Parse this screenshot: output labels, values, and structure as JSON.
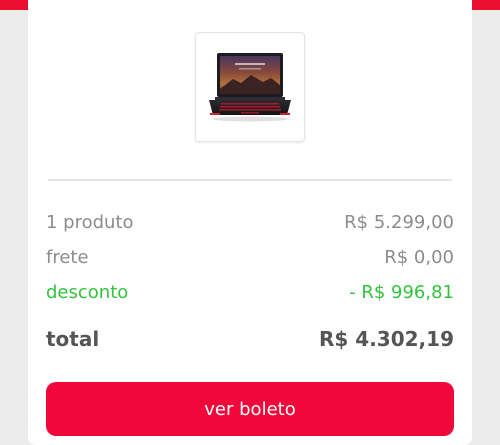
{
  "summary": {
    "product": {
      "label": "1 produto",
      "value": "R$ 5.299,00"
    },
    "shipping": {
      "label": "frete",
      "value": "R$ 0,00"
    },
    "discount": {
      "label": "desconto",
      "value": "- R$ 996,81"
    },
    "total": {
      "label": "total",
      "value": "R$ 4.302,19"
    }
  },
  "action": {
    "label": "ver boleto"
  },
  "colors": {
    "brand_red": "#f1083a",
    "discount_green": "#33c33d",
    "muted_text": "#8c8c8c"
  },
  "icons": {
    "product_image": "laptop-product-image"
  }
}
